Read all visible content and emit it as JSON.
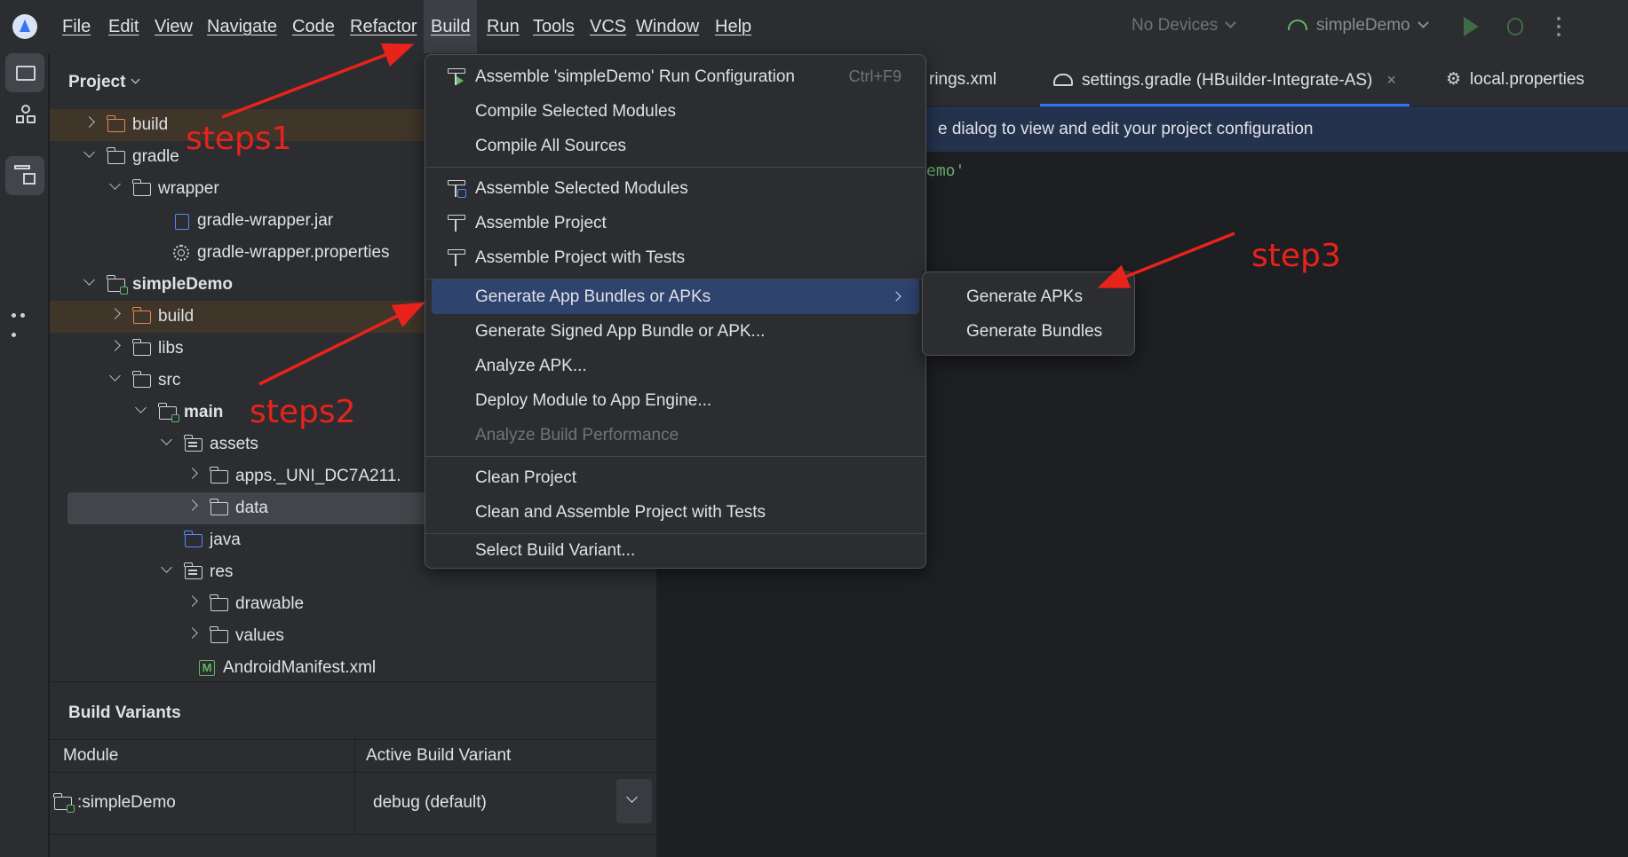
{
  "menubar": {
    "items": [
      {
        "label": "File",
        "name": "menu-file"
      },
      {
        "label": "Edit",
        "name": "menu-edit"
      },
      {
        "label": "View",
        "name": "menu-view"
      },
      {
        "label": "Navigate",
        "name": "menu-navigate"
      },
      {
        "label": "Code",
        "name": "menu-code"
      },
      {
        "label": "Refactor",
        "name": "menu-refactor"
      },
      {
        "label": "Build",
        "name": "menu-build"
      },
      {
        "label": "Run",
        "name": "menu-run"
      },
      {
        "label": "Tools",
        "name": "menu-tools"
      },
      {
        "label": "VCS",
        "name": "menu-vcs"
      },
      {
        "label": "Window",
        "name": "menu-window"
      },
      {
        "label": "Help",
        "name": "menu-help"
      }
    ],
    "device_selector": "No Devices",
    "run_config": "simpleDemo"
  },
  "project": {
    "title": "Project",
    "tree": [
      {
        "label": "build",
        "icon": "folder-icon"
      },
      {
        "label": "gradle",
        "icon": "folder-icon"
      },
      {
        "label": "wrapper",
        "icon": "folder-icon"
      },
      {
        "label": "gradle-wrapper.jar",
        "icon": "jar-icon"
      },
      {
        "label": "gradle-wrapper.properties",
        "icon": "gear-icon"
      },
      {
        "label": "simpleDemo",
        "icon": "module-folder-icon"
      },
      {
        "label": "build",
        "icon": "folder-icon"
      },
      {
        "label": "libs",
        "icon": "folder-icon"
      },
      {
        "label": "src",
        "icon": "folder-icon"
      },
      {
        "label": "main",
        "icon": "module-folder-icon"
      },
      {
        "label": "assets",
        "icon": "resource-folder-icon"
      },
      {
        "label": "apps._UNI_DC7A211.",
        "icon": "folder-icon"
      },
      {
        "label": "data",
        "icon": "folder-icon"
      },
      {
        "label": "java",
        "icon": "source-folder-icon"
      },
      {
        "label": "res",
        "icon": "resource-folder-icon"
      },
      {
        "label": "drawable",
        "icon": "folder-icon"
      },
      {
        "label": "values",
        "icon": "folder-icon"
      },
      {
        "label": "AndroidManifest.xml",
        "icon": "manifest-icon"
      }
    ]
  },
  "build_variants": {
    "title": "Build Variants",
    "col_module": "Module",
    "col_variant": "Active Build Variant",
    "row_module": ":simpleDemo",
    "row_variant": "debug (default)"
  },
  "editor": {
    "tabs": [
      {
        "label": "rings.xml"
      },
      {
        "label": "settings.gradle (HBuilder-Integrate-AS)"
      },
      {
        "label": "local.properties"
      }
    ],
    "tab_close": "×",
    "notice": "e dialog to view and edit your project configuration",
    "code_line": "emo'"
  },
  "build_menu": {
    "items": [
      {
        "label": "Assemble 'simpleDemo' Run Configuration",
        "shortcut": "Ctrl+F9",
        "icon": "hammer-run-icon"
      },
      {
        "label": "Compile Selected Modules"
      },
      {
        "label": "Compile All Sources"
      },
      {
        "label": "Assemble Selected Modules",
        "icon": "hammer-module-icon"
      },
      {
        "label": "Assemble Project",
        "icon": "hammer-icon"
      },
      {
        "label": "Assemble Project with Tests",
        "icon": "hammer-icon"
      },
      {
        "label": "Generate App Bundles or APKs"
      },
      {
        "label": "Generate Signed App Bundle or APK..."
      },
      {
        "label": "Analyze APK..."
      },
      {
        "label": "Deploy Module to App Engine..."
      },
      {
        "label": "Analyze Build Performance"
      },
      {
        "label": "Clean Project"
      },
      {
        "label": "Clean and Assemble Project with Tests"
      },
      {
        "label": "Select Build Variant..."
      }
    ]
  },
  "submenu": {
    "items": [
      {
        "label": "Generate APKs"
      },
      {
        "label": "Generate Bundles"
      }
    ]
  },
  "annotations": {
    "step1": "steps1",
    "step2": "steps2",
    "step3": "step3",
    "color": "#e8231c"
  },
  "colors": {
    "accent": "#3574f0",
    "menu_highlight": "#2e436e",
    "build_folder": "#e08855",
    "module_badge": "#5fb865"
  }
}
